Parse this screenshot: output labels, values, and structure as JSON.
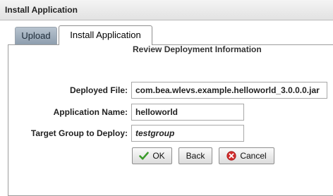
{
  "window": {
    "title": "Install Application"
  },
  "tabs": [
    {
      "label": "Upload",
      "active": false
    },
    {
      "label": "Install Application",
      "active": true
    }
  ],
  "section": {
    "title": "Review Deployment Information"
  },
  "form": {
    "deployed_file": {
      "label": "Deployed File:",
      "value": "com.bea.wlevs.example.helloworld_3.0.0.0.jar"
    },
    "application_name": {
      "label": "Application Name:",
      "value": "helloworld"
    },
    "target_group": {
      "label": "Target Group to Deploy:",
      "value": "testgroup"
    }
  },
  "buttons": {
    "ok": {
      "label": "OK",
      "icon": "check-icon"
    },
    "back": {
      "label": "Back"
    },
    "cancel": {
      "label": "Cancel",
      "icon": "cancel-icon"
    }
  },
  "colors": {
    "ok_icon": "#3a9a2a",
    "cancel_icon": "#d22b2b"
  }
}
